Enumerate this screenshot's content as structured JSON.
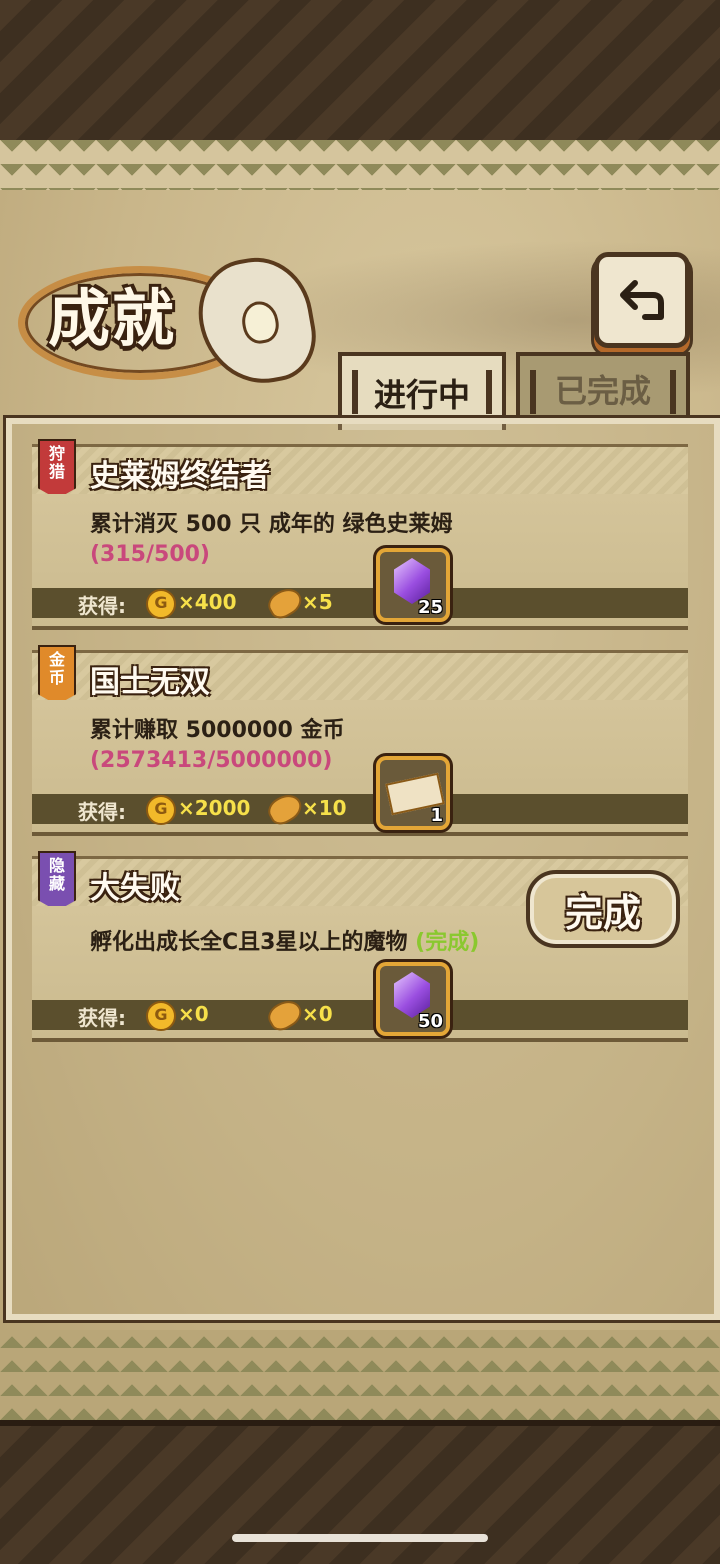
{
  "header": {
    "title": "成就"
  },
  "tabs": [
    {
      "label": "进行中",
      "active": true
    },
    {
      "label": "已完成",
      "active": false
    }
  ],
  "reward_label": "获得:",
  "coin_symbol": "G",
  "achievements": [
    {
      "tag": "狩猎",
      "tag_color": "#c23a3a",
      "name": "史莱姆终结者",
      "description": "累计消灭 500 只 成年的 绿色史莱姆",
      "progress": "(315/500)",
      "gold": "×400",
      "bread": "×5",
      "item": "crystal",
      "item_count": "25"
    },
    {
      "tag": "金币",
      "tag_color": "#e08a2a",
      "name": "国士无双",
      "description": "累计赚取 5000000 金币",
      "progress": "(2573413/5000000)",
      "gold": "×2000",
      "bread": "×10",
      "item": "ticket",
      "item_count": "1"
    },
    {
      "tag": "隐藏",
      "tag_color": "#7a4fb0",
      "name": "大失败",
      "description": "孵化出成长全C且3星以上的魔物",
      "status": "(完成)",
      "gold": "×0",
      "bread": "×0",
      "item": "crystal",
      "item_count": "50",
      "button_label": "完成"
    }
  ]
}
